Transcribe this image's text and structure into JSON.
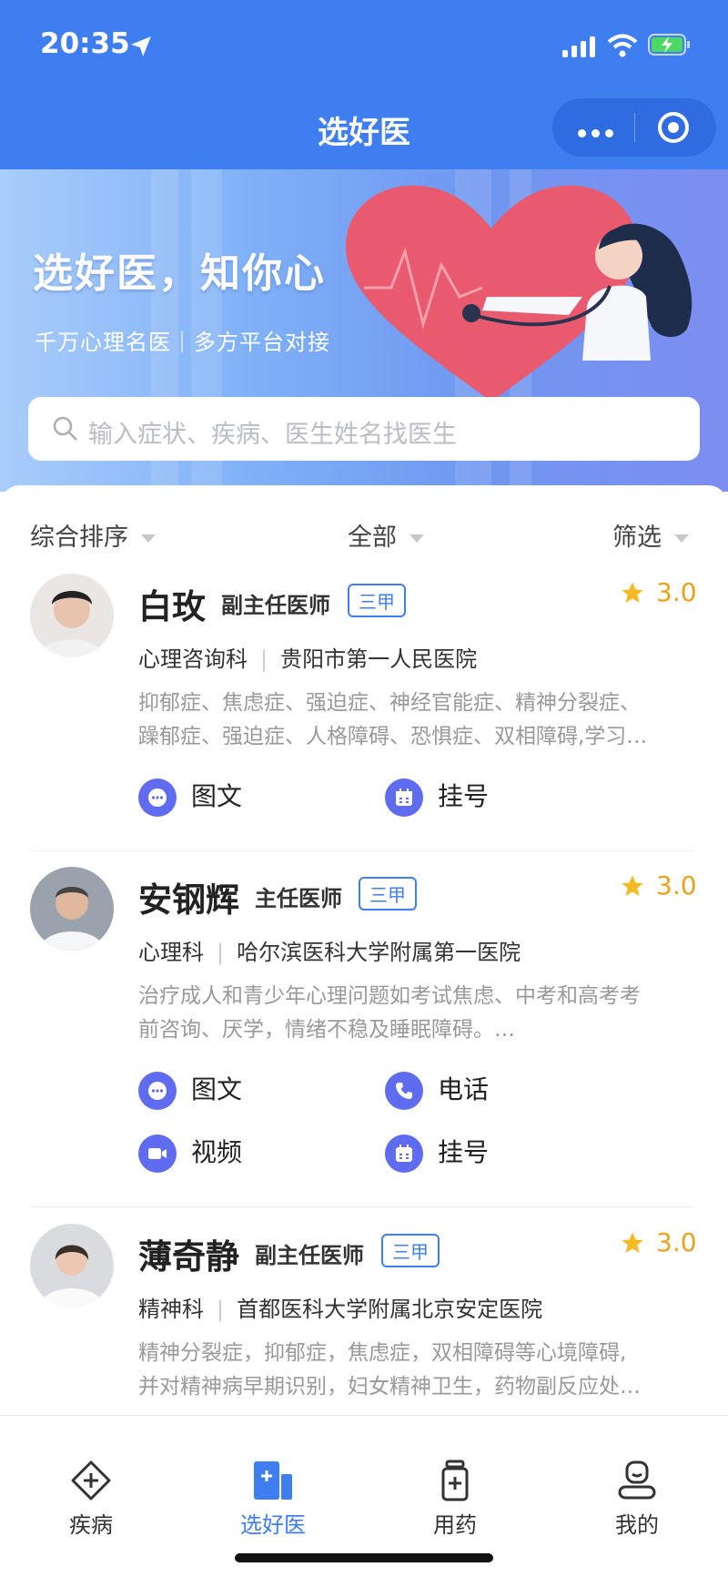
{
  "status": {
    "time": "20:35"
  },
  "header": {
    "title": "选好医"
  },
  "banner": {
    "slogan": "选好医，知你心",
    "subtitle": "千万心理名医｜多方平台对接"
  },
  "search": {
    "placeholder": "输入症状、疾病、医生姓名找医生"
  },
  "sort": {
    "left": "综合排序",
    "middle": "全部",
    "right": "筛选"
  },
  "doctors": [
    {
      "name": "白玫",
      "title": "副主任医师",
      "badge": "三甲",
      "rating": "3.0",
      "dept": "心理咨询科",
      "hospital": "贵阳市第一人民医院",
      "desc1": "抑郁症、焦虑症、强迫症、神经官能症、精神分裂症、",
      "desc2": "躁郁症、强迫症、人格障碍、恐惧症、双相障碍,学习…",
      "services": [
        {
          "label": "图文",
          "icon": "chat-icon"
        },
        {
          "label": "挂号",
          "icon": "calendar-icon"
        }
      ]
    },
    {
      "name": "安钢辉",
      "title": "主任医师",
      "badge": "三甲",
      "rating": "3.0",
      "dept": "心理科",
      "hospital": "哈尔滨医科大学附属第一医院",
      "desc1": "治疗成人和青少年心理问题如考试焦虑、中考和高考考",
      "desc2": "前咨询、厌学，情绪不稳及睡眠障碍。…",
      "services": [
        {
          "label": "图文",
          "icon": "chat-icon"
        },
        {
          "label": "电话",
          "icon": "phone-icon"
        },
        {
          "label": "视频",
          "icon": "video-icon"
        },
        {
          "label": "挂号",
          "icon": "calendar-icon"
        }
      ]
    },
    {
      "name": "薄奇静",
      "title": "副主任医师",
      "badge": "三甲",
      "rating": "3.0",
      "dept": "精神科",
      "hospital": "首都医科大学附属北京安定医院",
      "desc1": "精神分裂症，抑郁症，焦虑症，双相障碍等心境障碍,",
      "desc2": "并对精神病早期识别，妇女精神卫生，药物副反应处…"
    }
  ],
  "tabs": [
    {
      "label": "疾病",
      "icon": "diamond-plus-icon"
    },
    {
      "label": "选好医",
      "icon": "doctor-card-icon",
      "active": true
    },
    {
      "label": "用药",
      "icon": "medicine-bottle-icon"
    },
    {
      "label": "我的",
      "icon": "profile-icon"
    }
  ],
  "colors": {
    "primary": "#3f7ef0",
    "service": "#5f6cf0",
    "rating": "#e9a21a"
  }
}
